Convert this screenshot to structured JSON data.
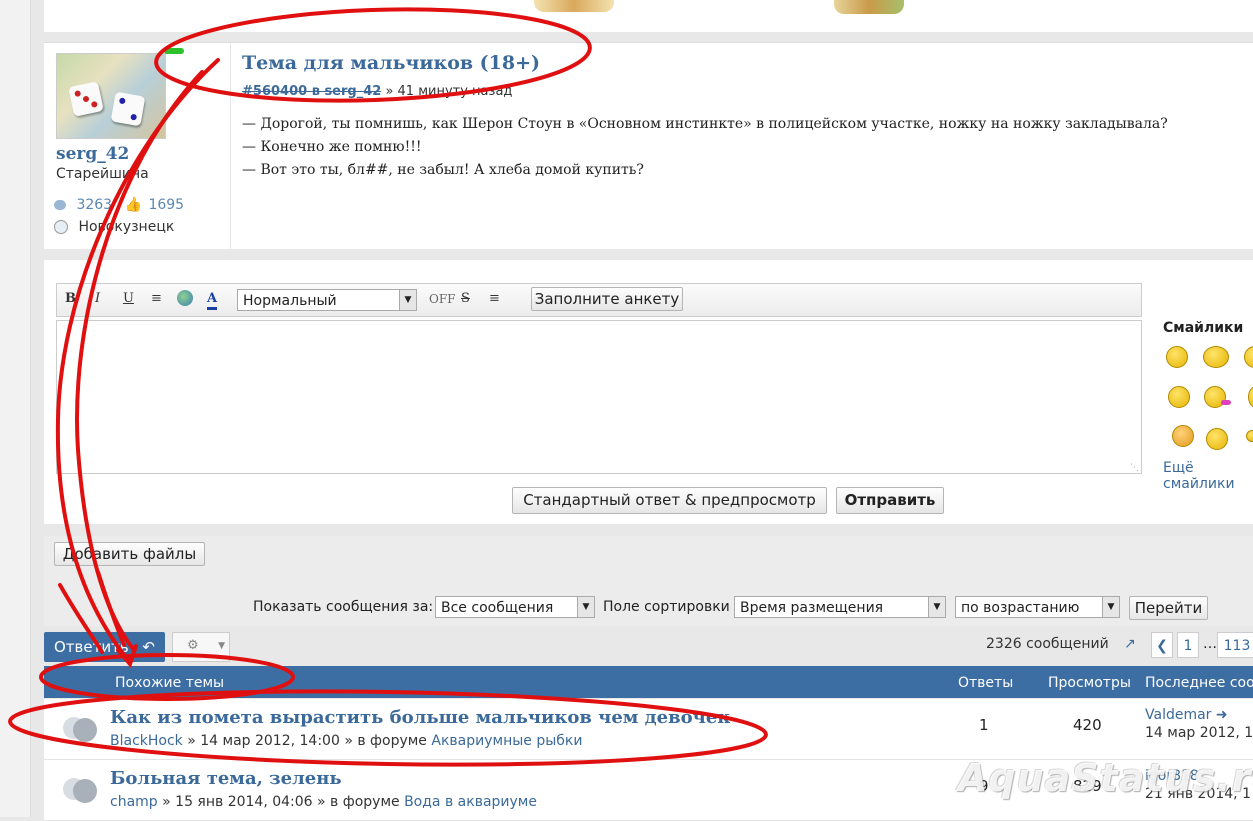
{
  "post": {
    "title": "Тема для мальчиков (18+)",
    "meta_link": "#560400 в serg_42",
    "meta_time": "» 41 минуту назад",
    "lines": [
      "— Дорогой, ты помнишь, как Шерон Стоун в «Основном инстинкте» в полицейском участке, ножку на ножку закладывала?",
      "— Конечно же помню!!!",
      "— Вот это ты, бл##, не забыл! А хлеба домой купить?"
    ],
    "author": {
      "username": "serg_42",
      "rank": "Старейшина",
      "posts": "3263",
      "likes": "1695",
      "location": "Новокузнецк"
    }
  },
  "editor": {
    "font_size_value": "Нормальный",
    "off_label": "OFF",
    "survey_button": "Заполните анкету",
    "preview_button": "Стандартный ответ & предпросмотр",
    "submit_button": "Отправить",
    "smilies_title": "Смайлики",
    "more_smilies": "Ещё смайлики"
  },
  "upload": {
    "add_files": "Добавить файлы",
    "show_label": "Показать сообщения за:",
    "show_value": "Все сообщения",
    "sort_label": "Поле сортировки",
    "sort_value": "Время размещения",
    "order_value": "по возрастанию",
    "go_button": "Перейти"
  },
  "pagination": {
    "reply_button": "Ответить",
    "count": "2326 сообщений",
    "page_first": "1",
    "ellipsis": "…",
    "page_last": "113"
  },
  "similar": {
    "header": "Похожие темы",
    "col_replies": "Ответы",
    "col_views": "Просмотры",
    "col_last": "Последнее сообщение",
    "rows": [
      {
        "title": "Как из помета вырастить больше мальчиков чем девочек",
        "author": "BlackHock",
        "date": "» 14 мар 2012, 14:00 » в форуме",
        "forum": "Аквариумные рыбки",
        "replies": "1",
        "views": "420",
        "last_user": "Valdemar",
        "last_date": "14 мар 2012, 1"
      },
      {
        "title": "Больная тема, зелень",
        "author": "champ",
        "date": "» 15 янв 2014, 04:06 » в форуме",
        "forum": "Вода в аквариуме",
        "replies": "9",
        "views": "829",
        "last_user": "igor818",
        "last_date": "21 янв 2014, 1"
      }
    ]
  },
  "watermark": "AquaStatus.ru",
  "colors": {
    "accent": "#3d6ea3",
    "link": "#3b6a9a",
    "annotation": "#e01010",
    "online": "#2dc22d"
  }
}
